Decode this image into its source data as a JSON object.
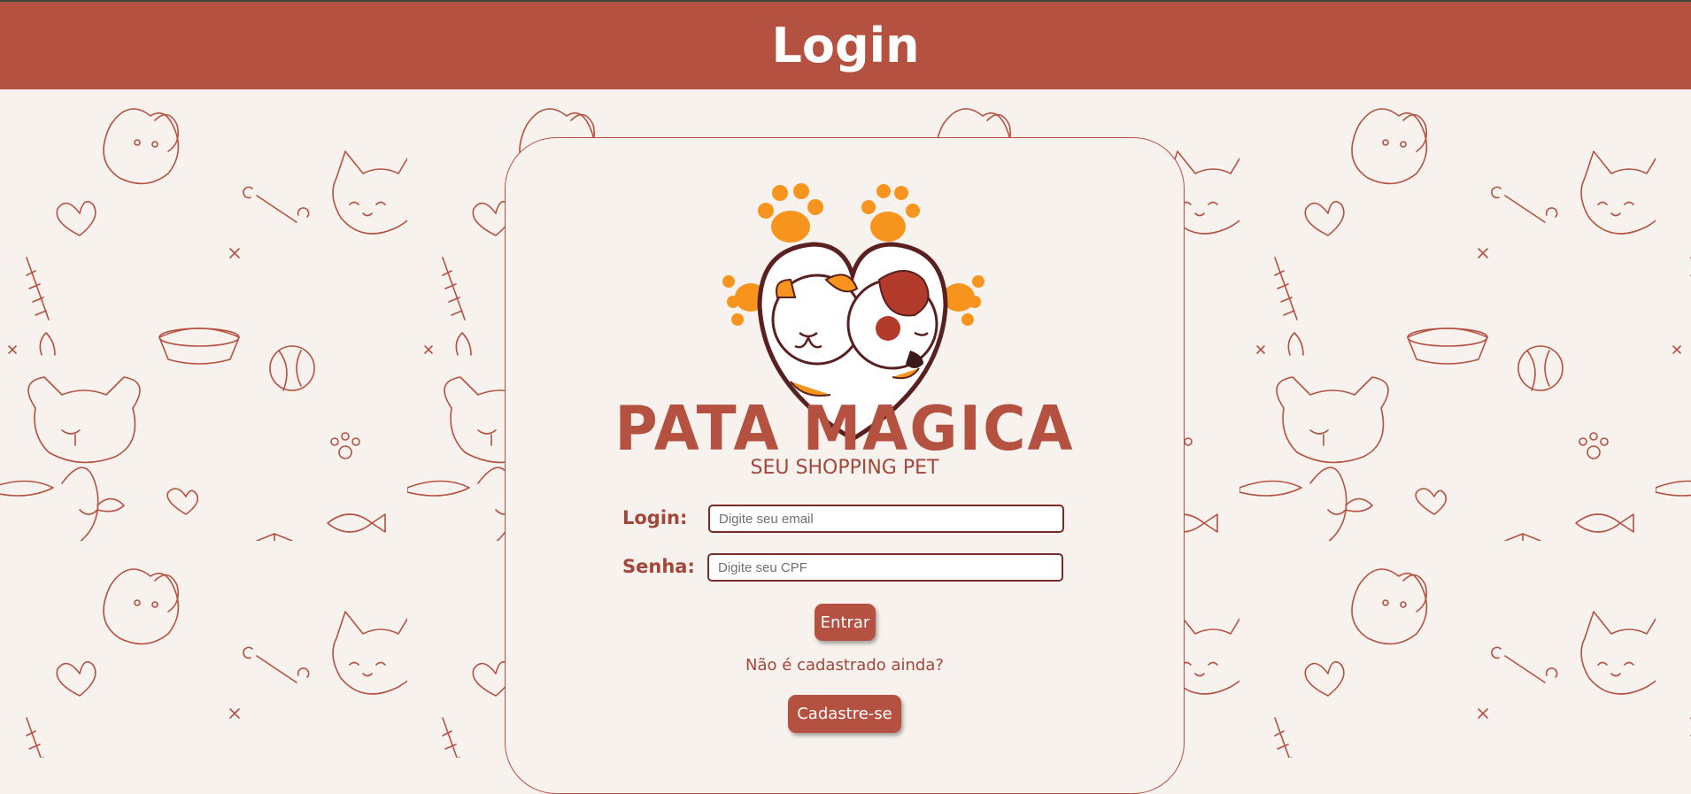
{
  "header": {
    "title": "Login"
  },
  "brand": {
    "name": "PATA MAGICA",
    "tagline": "SEU SHOPPING PET"
  },
  "form": {
    "login_label": "Login:",
    "login_placeholder": "Digite seu email",
    "password_label": "Senha:",
    "password_placeholder": "Digite seu CPF",
    "submit_label": "Entrar"
  },
  "signup": {
    "prompt": "Não é cadastrado ainda?",
    "button_label": "Cadastre-se"
  },
  "colors": {
    "primary": "#b45141",
    "background": "#f7f2ee",
    "accent_orange": "#f7941d",
    "pattern_stroke": "#b45141"
  }
}
